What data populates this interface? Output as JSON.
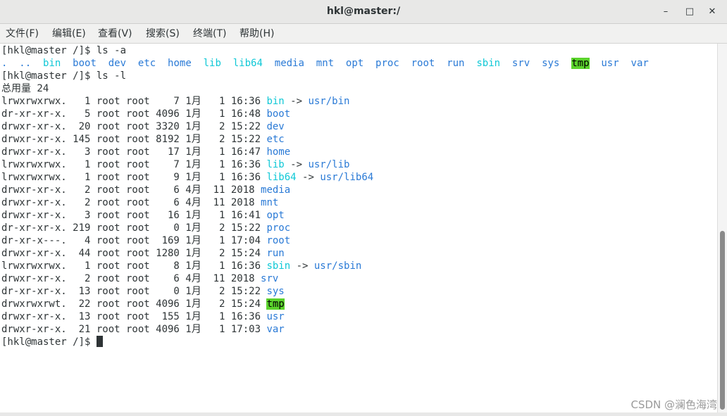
{
  "window": {
    "title": "hkl@master:/",
    "minimize": "–",
    "maximize": "□",
    "close": "✕"
  },
  "menu": [
    "文件(F)",
    "编辑(E)",
    "查看(V)",
    "搜索(S)",
    "终端(T)",
    "帮助(H)"
  ],
  "terminal": {
    "lines": [
      [
        {
          "t": "[hkl@master /]$ ls -a",
          "c": ""
        }
      ],
      [
        {
          "t": ".  ..  ",
          "c": "dir"
        },
        {
          "t": "bin",
          "c": "cyan"
        },
        {
          "t": "  ",
          "c": ""
        },
        {
          "t": "boot  dev  etc  home",
          "c": "dir"
        },
        {
          "t": "  ",
          "c": ""
        },
        {
          "t": "lib  lib64",
          "c": "cyan"
        },
        {
          "t": "  ",
          "c": ""
        },
        {
          "t": "media  mnt  opt  proc  root  run",
          "c": "dir"
        },
        {
          "t": "  ",
          "c": ""
        },
        {
          "t": "sbin",
          "c": "cyan"
        },
        {
          "t": "  ",
          "c": ""
        },
        {
          "t": "srv  sys",
          "c": "dir"
        },
        {
          "t": "  ",
          "c": ""
        },
        {
          "t": "tmp",
          "c": "tmp"
        },
        {
          "t": "  ",
          "c": ""
        },
        {
          "t": "usr  var",
          "c": "dir"
        }
      ],
      [
        {
          "t": "[hkl@master /]$ ls -l",
          "c": ""
        }
      ],
      [
        {
          "t": "总用量 24",
          "c": ""
        }
      ],
      [
        {
          "t": "lrwxrwxrwx.   1 root root    7 1月   1 16:36 ",
          "c": ""
        },
        {
          "t": "bin",
          "c": "cyan"
        },
        {
          "t": " -> ",
          "c": ""
        },
        {
          "t": "usr/bin",
          "c": "dir"
        }
      ],
      [
        {
          "t": "dr-xr-xr-x.   5 root root 4096 1月   1 16:48 ",
          "c": ""
        },
        {
          "t": "boot",
          "c": "dir"
        }
      ],
      [
        {
          "t": "drwxr-xr-x.  20 root root 3320 1月   2 15:22 ",
          "c": ""
        },
        {
          "t": "dev",
          "c": "dir"
        }
      ],
      [
        {
          "t": "drwxr-xr-x. 145 root root 8192 1月   2 15:22 ",
          "c": ""
        },
        {
          "t": "etc",
          "c": "dir"
        }
      ],
      [
        {
          "t": "drwxr-xr-x.   3 root root   17 1月   1 16:47 ",
          "c": ""
        },
        {
          "t": "home",
          "c": "dir"
        }
      ],
      [
        {
          "t": "lrwxrwxrwx.   1 root root    7 1月   1 16:36 ",
          "c": ""
        },
        {
          "t": "lib",
          "c": "cyan"
        },
        {
          "t": " -> ",
          "c": ""
        },
        {
          "t": "usr/lib",
          "c": "dir"
        }
      ],
      [
        {
          "t": "lrwxrwxrwx.   1 root root    9 1月   1 16:36 ",
          "c": ""
        },
        {
          "t": "lib64",
          "c": "cyan"
        },
        {
          "t": " -> ",
          "c": ""
        },
        {
          "t": "usr/lib64",
          "c": "dir"
        }
      ],
      [
        {
          "t": "drwxr-xr-x.   2 root root    6 4月  11 2018 ",
          "c": ""
        },
        {
          "t": "media",
          "c": "dir"
        }
      ],
      [
        {
          "t": "drwxr-xr-x.   2 root root    6 4月  11 2018 ",
          "c": ""
        },
        {
          "t": "mnt",
          "c": "dir"
        }
      ],
      [
        {
          "t": "drwxr-xr-x.   3 root root   16 1月   1 16:41 ",
          "c": ""
        },
        {
          "t": "opt",
          "c": "dir"
        }
      ],
      [
        {
          "t": "dr-xr-xr-x. 219 root root    0 1月   2 15:22 ",
          "c": ""
        },
        {
          "t": "proc",
          "c": "dir"
        }
      ],
      [
        {
          "t": "dr-xr-x---.   4 root root  169 1月   1 17:04 ",
          "c": ""
        },
        {
          "t": "root",
          "c": "dir"
        }
      ],
      [
        {
          "t": "drwxr-xr-x.  44 root root 1280 1月   2 15:24 ",
          "c": ""
        },
        {
          "t": "run",
          "c": "dir"
        }
      ],
      [
        {
          "t": "lrwxrwxrwx.   1 root root    8 1月   1 16:36 ",
          "c": ""
        },
        {
          "t": "sbin",
          "c": "cyan"
        },
        {
          "t": " -> ",
          "c": ""
        },
        {
          "t": "usr/sbin",
          "c": "dir"
        }
      ],
      [
        {
          "t": "drwxr-xr-x.   2 root root    6 4月  11 2018 ",
          "c": ""
        },
        {
          "t": "srv",
          "c": "dir"
        }
      ],
      [
        {
          "t": "dr-xr-xr-x.  13 root root    0 1月   2 15:22 ",
          "c": ""
        },
        {
          "t": "sys",
          "c": "dir"
        }
      ],
      [
        {
          "t": "drwxrwxrwt.  22 root root 4096 1月   2 15:24 ",
          "c": ""
        },
        {
          "t": "tmp",
          "c": "tmp"
        }
      ],
      [
        {
          "t": "drwxr-xr-x.  13 root root  155 1月   1 16:36 ",
          "c": ""
        },
        {
          "t": "usr",
          "c": "dir"
        }
      ],
      [
        {
          "t": "drwxr-xr-x.  21 root root 4096 1月   1 17:03 ",
          "c": ""
        },
        {
          "t": "var",
          "c": "dir"
        }
      ],
      [
        {
          "t": "[hkl@master /]$ ",
          "c": ""
        },
        {
          "t": "",
          "c": "cursor"
        }
      ]
    ]
  },
  "watermark": "CSDN @澜色海湾",
  "colors": {
    "symlink": "#0fc8d6",
    "directory": "#2a7ad6",
    "sticky_bg": "#5bd32c",
    "text": "#2e3436"
  }
}
